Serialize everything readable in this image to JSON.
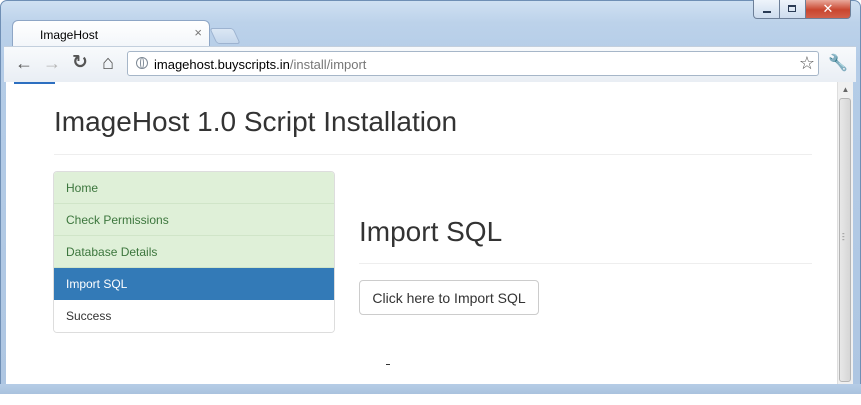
{
  "window": {
    "controls": {
      "minimize": "minimize",
      "maximize": "maximize",
      "close": "✕"
    }
  },
  "tab": {
    "title": "ImageHost",
    "close": "×"
  },
  "toolbar": {
    "back": "←",
    "forward": "→",
    "reload": "↻",
    "home": "⌂",
    "url_host": "imagehost.buyscripts.in",
    "url_path": "/install/import",
    "bookmark_star": "☆",
    "wrench": "🔧"
  },
  "icons": [
    "globe-icon",
    "back-arrow-icon",
    "forward-arrow-icon",
    "reload-icon",
    "home-icon",
    "star-icon",
    "wrench-icon"
  ],
  "page": {
    "title": "ImageHost 1.0 Script Installation",
    "steps": [
      {
        "label": "Home",
        "state": "done"
      },
      {
        "label": "Check Permissions",
        "state": "done"
      },
      {
        "label": "Database Details",
        "state": "done"
      },
      {
        "label": "Import SQL",
        "state": "active"
      },
      {
        "label": "Success",
        "state": "todo"
      }
    ],
    "section_title": "Import SQL",
    "import_button": "Click here to Import SQL"
  },
  "colors": {
    "step_done_bg": "#dff0d8",
    "step_done_text": "#3c763d",
    "step_active_bg": "#337ab7",
    "accent": "#2d6fc0"
  }
}
